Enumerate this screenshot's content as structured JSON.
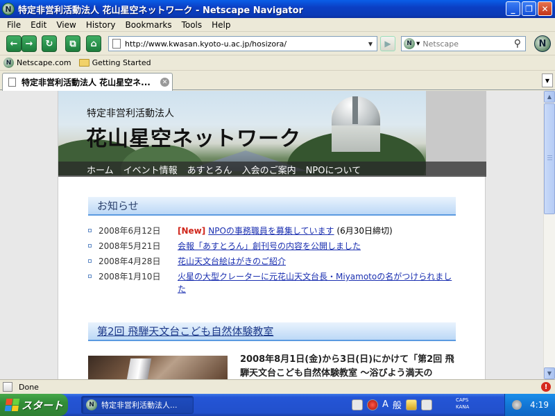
{
  "window": {
    "title": "特定非営利活動法人 花山星空ネットワーク - Netscape Navigator",
    "app_icon": "N",
    "min_glyph": "_",
    "max_glyph": "❐",
    "close_glyph": "✕"
  },
  "menu": [
    "File",
    "Edit",
    "View",
    "History",
    "Bookmarks",
    "Tools",
    "Help"
  ],
  "toolbar": {
    "back_glyph": "←",
    "forward_glyph": "→",
    "reload_glyph": "↻",
    "newtab_glyph": "⧉",
    "home_glyph": "⌂",
    "url": "http://www.kwasan.kyoto-u.ac.jp/hosizora/",
    "go_glyph": "▶",
    "search_placeholder": "Netscape",
    "search_engine": "N"
  },
  "bookmarks": [
    {
      "label": "Netscape.com",
      "icon": "netscape-icon"
    },
    {
      "label": "Getting Started",
      "icon": "folder-icon"
    }
  ],
  "tab": {
    "label": "特定非営利活動法人 花山星空ネ...",
    "close_glyph": "✕"
  },
  "site": {
    "subtitle": "特定非営利活動法人",
    "title": "花山星空ネットワーク",
    "nav": [
      "ホーム",
      "イベント情報",
      "あすとろん",
      "入会のご案内",
      "NPOについて"
    ]
  },
  "news": {
    "heading": "お知らせ",
    "items": [
      {
        "date": "2008年6月12日",
        "badge": "[New]",
        "link": "NPOの事務職員を募集しています",
        "suffix": "(6月30日締切)"
      },
      {
        "date": "2008年5月21日",
        "badge": "",
        "link": "会報「あすとろん」創刊号の内容を公開しました",
        "suffix": ""
      },
      {
        "date": "2008年4月28日",
        "badge": "",
        "link": "花山天文台絵はがきのご紹介",
        "suffix": ""
      },
      {
        "date": "2008年1月10日",
        "badge": "",
        "link": "火星の大型クレーターに元花山天文台長・Miyamotoの名がつけられました",
        "suffix": ""
      }
    ]
  },
  "event": {
    "heading": "第2回 飛騨天文台こども自然体験教室",
    "text": "2008年8月1日(金)から3日(日)にかけて「第2回 飛騨天文台こども自然体験教室 ～浴びよう満天の"
  },
  "status": {
    "text": "Done",
    "alert_glyph": "!"
  },
  "taskbar": {
    "start_label": "スタート",
    "task_label": "特定非営利活動法人...",
    "ime_a": "A",
    "ime_kanji": "般",
    "caps": "CAPS",
    "kana": "KANA",
    "time": "4:19"
  },
  "colors": {
    "link": "#1a2fb0",
    "new_badge": "#d0261b",
    "heading_bar": "#bcd8f6"
  }
}
